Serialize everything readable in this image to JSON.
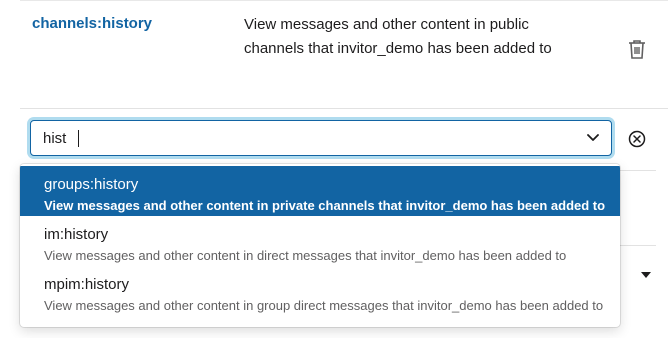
{
  "scope_row": {
    "name": "channels:history",
    "description": "View messages and other content in public channels that invitor_demo has been added to"
  },
  "icons": {
    "trash": "trash-icon",
    "chevron": "chevron-down-icon",
    "clear": "close-circle-icon"
  },
  "search": {
    "value": "hist",
    "placeholder": ""
  },
  "dropdown": {
    "options": [
      {
        "name": "groups:history",
        "description": "View messages and other content in private channels that invitor_demo has been added to"
      },
      {
        "name": "im:history",
        "description": "View messages and other content in direct messages that invitor_demo has been added to"
      },
      {
        "name": "mpim:history",
        "description": "View messages and other content in group direct messages that invitor_demo has been added to"
      }
    ]
  },
  "colors": {
    "accent": "#1264a3",
    "focus_ring": "#1d9bd1",
    "text": "#1d1c1d",
    "muted_text": "#616061"
  }
}
